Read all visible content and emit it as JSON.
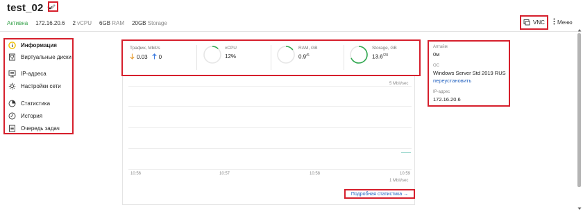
{
  "vm": {
    "name": "test_02",
    "status": "Активна",
    "ip": "172.16.20.6",
    "vcpu_num": "2",
    "vcpu_unit": "vCPU",
    "ram_num": "6GB",
    "ram_unit": "RAM",
    "storage_num": "20GB",
    "storage_unit": "Storage"
  },
  "toolbar": {
    "vnc_label": "VNC",
    "menu_label": "Меню"
  },
  "sidebar": {
    "items": [
      {
        "label": "Информация",
        "icon": "info-icon",
        "active": true
      },
      {
        "label": "Виртуальные диски",
        "icon": "disk-icon"
      },
      {
        "label": "IP-адреса",
        "icon": "ip-icon"
      },
      {
        "label": "Настройки сети",
        "icon": "network-gear-icon"
      },
      {
        "label": "Статистика",
        "icon": "pie-chart-icon"
      },
      {
        "label": "История",
        "icon": "clock-icon"
      },
      {
        "label": "Очередь задач",
        "icon": "task-list-icon"
      }
    ]
  },
  "metrics": {
    "traffic": {
      "label": "Трафик, Mbit/s",
      "down": "0.03",
      "up": "0"
    },
    "vcpu": {
      "label": "vCPU",
      "value": "12%",
      "fraction": 0.12
    },
    "ram": {
      "label": "RAM, GB",
      "value": "0.9",
      "total": "6",
      "fraction": 0.15
    },
    "storage": {
      "label": "Storage, GB",
      "value": "13.6",
      "total": "20",
      "fraction": 0.68
    }
  },
  "chart": {
    "y_top_label": "5 Mbit/sec",
    "y_bottom_label": "1 Mbit/sec",
    "x_ticks": [
      "10:56",
      "10:57",
      "10:58",
      "10:59"
    ]
  },
  "details_link": "Подробная статистика →",
  "info": {
    "uptime_label": "Аптайм",
    "uptime_value": "0м",
    "os_label": "ОС",
    "os_value": "Windows Server Std 2019 RUS",
    "reinstall": "переустановить",
    "ip_label": "IP-адрес",
    "ip_value": "172.16.20.6"
  },
  "colors": {
    "highlight": "#d61f2c",
    "active_status": "#2f9e44",
    "ring": "#2fa84f",
    "link": "#1f5fbf",
    "traffic_down": "#e8a13a",
    "traffic_up": "#3b7be0"
  }
}
